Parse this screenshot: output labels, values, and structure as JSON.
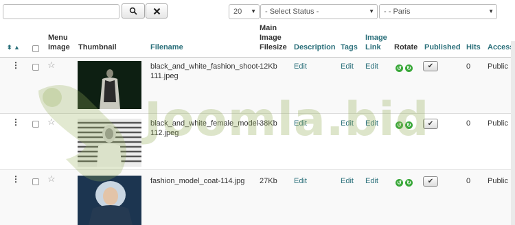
{
  "toolbar": {
    "search_value": "",
    "limit": "20",
    "status": "- Select Status -",
    "city": "- - Paris"
  },
  "header": {
    "menu_image": [
      "Menu",
      "Image"
    ],
    "thumbnail": "Thumbnail",
    "filename": "Filename",
    "filesize": [
      "Main",
      "Image",
      "Filesize"
    ],
    "description": "Description",
    "tags": "Tags",
    "image_link": [
      "Image",
      "Link"
    ],
    "rotate": "Rotate",
    "published": "Published",
    "hits": "Hits",
    "access": "Access"
  },
  "rows": [
    {
      "filename": [
        "black_and_white_fashion_shoot-",
        "111.jpeg"
      ],
      "filesize": "12Kb",
      "description": "Edit",
      "tags": "Edit",
      "image_link": "Edit",
      "hits": "0",
      "access": "Public"
    },
    {
      "filename": [
        "black_and_white_female_model-",
        "112.jpeg"
      ],
      "filesize": "38Kb",
      "description": "Edit",
      "tags": "Edit",
      "image_link": "Edit",
      "hits": "0",
      "access": "Public"
    },
    {
      "filename": [
        "fashion_model_coat-114.jpg"
      ],
      "filesize": "27Kb",
      "description": "Edit",
      "tags": "Edit",
      "image_link": "Edit",
      "hits": "0",
      "access": "Public"
    }
  ],
  "watermark": "Joomla.bid",
  "icons": {
    "search": "search-icon",
    "clear": "close-icon",
    "sort": "sort-arrows-icon",
    "drag": "drag-handle-icon",
    "star": "star-icon",
    "rotate_left": "rotate-left-icon",
    "rotate_right": "rotate-right-icon",
    "published": "check-icon"
  },
  "colors": {
    "link": "#2a6f7a",
    "rotate": "#3aa83a",
    "watermark": "#96af5a"
  }
}
